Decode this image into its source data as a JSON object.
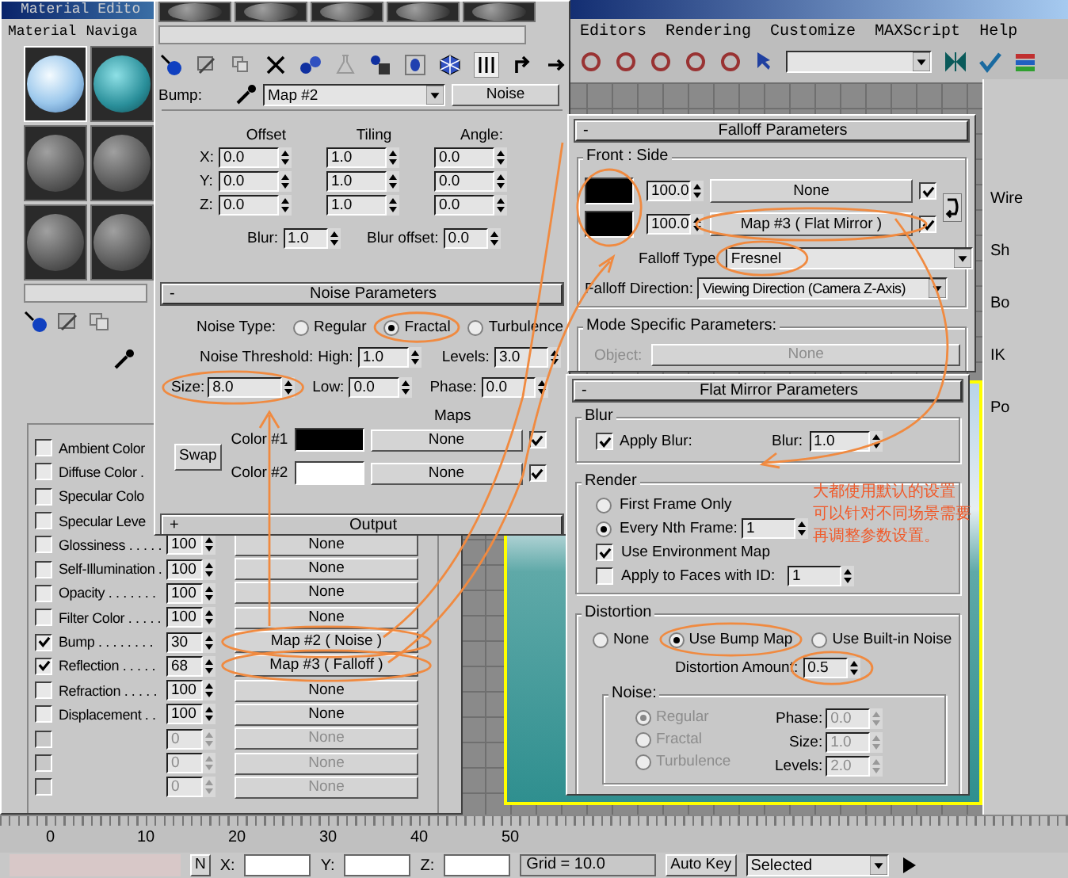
{
  "app": {
    "menu": [
      "Editors",
      "Rendering",
      "Customize",
      "MAXScript",
      "Help"
    ],
    "command_panel": [
      "Wire",
      "Sh",
      "Bo",
      "IK",
      "Po"
    ]
  },
  "back_editor": {
    "title": "Material Edito",
    "menu": [
      "Material",
      "Naviga"
    ],
    "maps": [
      {
        "label": "Ambient Color",
        "checked": false,
        "disabled": false
      },
      {
        "label": "Diffuse Color .",
        "checked": false,
        "disabled": false
      },
      {
        "label": "Specular Colo",
        "checked": false,
        "disabled": false
      },
      {
        "label": "Specular Leve",
        "checked": false,
        "disabled": false
      },
      {
        "label": "Glossiness . . . . .",
        "checked": false,
        "disabled": false,
        "amount": "100",
        "map": "None"
      },
      {
        "label": "Self-Illumination .",
        "checked": false,
        "disabled": false,
        "amount": "100",
        "map": "None"
      },
      {
        "label": "Opacity . . . . . . .",
        "checked": false,
        "disabled": false,
        "amount": "100",
        "map": "None"
      },
      {
        "label": "Filter Color . . . . .",
        "checked": false,
        "disabled": false,
        "amount": "100",
        "map": "None"
      },
      {
        "label": "Bump . . . . . . . .",
        "checked": true,
        "disabled": false,
        "amount": "30",
        "map": "Map #2  ( Noise )"
      },
      {
        "label": "Reflection . . . . .",
        "checked": true,
        "disabled": false,
        "amount": "68",
        "map": "Map #3  ( Falloff )"
      },
      {
        "label": "Refraction . . . . .",
        "checked": false,
        "disabled": false,
        "amount": "100",
        "map": "None"
      },
      {
        "label": "Displacement . .",
        "checked": false,
        "disabled": false,
        "amount": "100",
        "map": "None"
      },
      {
        "checked": false,
        "disabled": true,
        "amount": "0",
        "map": "None"
      },
      {
        "checked": false,
        "disabled": true,
        "amount": "0",
        "map": "None"
      },
      {
        "checked": false,
        "disabled": true,
        "amount": "0",
        "map": "None"
      }
    ]
  },
  "front_editor": {
    "bump": {
      "label": "Bump:",
      "map": "Map #2",
      "type": "Noise"
    },
    "coords": {
      "columns": [
        "Offset",
        "Tiling",
        "Angle:"
      ],
      "rows": [
        {
          "axis": "X:",
          "values": [
            "0.0",
            "1.0",
            "0.0"
          ]
        },
        {
          "axis": "Y:",
          "values": [
            "0.0",
            "1.0",
            "0.0"
          ]
        },
        {
          "axis": "Z:",
          "values": [
            "0.0",
            "1.0",
            "0.0"
          ]
        }
      ],
      "blur": {
        "label": "Blur:",
        "value": "1.0"
      },
      "blur_offset": {
        "label": "Blur offset:",
        "value": "0.0"
      }
    },
    "noise": {
      "sign": "-",
      "title": "Noise Parameters",
      "type_label": "Noise Type:",
      "types": [
        {
          "label": "Regular",
          "selected": false
        },
        {
          "label": "Fractal",
          "selected": true
        },
        {
          "label": "Turbulence",
          "selected": false
        }
      ],
      "threshold_label": "Noise Threshold:",
      "high": {
        "label": "High:",
        "value": "1.0"
      },
      "levels": {
        "label": "Levels:",
        "value": "3.0"
      },
      "size": {
        "label": "Size:",
        "value": "8.0"
      },
      "low": {
        "label": "Low:",
        "value": "0.0"
      },
      "phase": {
        "label": "Phase:",
        "value": "0.0"
      },
      "maps_label": "Maps",
      "swap": "Swap",
      "colors": [
        {
          "label": "Color #1",
          "color": "#000000",
          "map": "None",
          "checked": true
        },
        {
          "label": "Color #2",
          "color": "#ffffff",
          "map": "None",
          "checked": true
        }
      ]
    },
    "output": {
      "sign": "+",
      "title": "Output"
    }
  },
  "falloff": {
    "sign": "-",
    "title": "Falloff Parameters",
    "group": "Front : Side",
    "rows": [
      {
        "color": "#000000",
        "value": "100.0",
        "map": "None",
        "checked": true
      },
      {
        "color": "#000000",
        "value": "100.0",
        "map": "Map #3  ( Flat Mirror )",
        "checked": true
      }
    ],
    "type": {
      "label": "Falloff Type:",
      "value": "Fresnel"
    },
    "direction": {
      "label": "Falloff Direction:",
      "value": "Viewing Direction (Camera Z-Axis)"
    },
    "mode_group": "Mode Specific Parameters:",
    "object": {
      "label": "Object:",
      "value": "None",
      "disabled": true
    }
  },
  "flat_mirror": {
    "sign": "-",
    "title": "Flat Mirror Parameters",
    "blur_group": "Blur",
    "apply_blur": {
      "label": "Apply Blur:",
      "checked": true
    },
    "blur": {
      "label": "Blur:",
      "value": "1.0"
    },
    "render_group": "Render",
    "render_modes": [
      {
        "label": "First Frame Only",
        "selected": false
      },
      {
        "label": "Every Nth Frame:",
        "selected": true
      }
    ],
    "nth_value": "1",
    "env_map": {
      "label": "Use Environment Map",
      "checked": true
    },
    "faces": {
      "label": "Apply to Faces with ID:",
      "checked": false,
      "value": "1"
    },
    "distortion_group": "Distortion",
    "distortion_modes": [
      {
        "label": "None",
        "selected": false
      },
      {
        "label": "Use Bump Map",
        "selected": true
      },
      {
        "label": "Use Built-in Noise",
        "selected": false
      }
    ],
    "amount": {
      "label": "Distortion Amount:",
      "value": "0.5"
    },
    "noise_group": "Noise:",
    "noise_disabled": true,
    "noise_types": [
      {
        "label": "Regular",
        "selected": true
      },
      {
        "label": "Fractal",
        "selected": false
      },
      {
        "label": "Turbulence",
        "selected": false
      }
    ],
    "phase": {
      "label": "Phase:",
      "value": "0.0"
    },
    "size": {
      "label": "Size:",
      "value": "1.0"
    },
    "levels": {
      "label": "Levels:",
      "value": "2.0"
    }
  },
  "annotation_note": [
    "大都使用默认的设置",
    "可以针对不同场景需要",
    "再调整参数设置。"
  ],
  "timeline": {
    "ticks": [
      "0",
      "10",
      "20",
      "30",
      "40",
      "50"
    ],
    "n_button": "N",
    "coord_labels": [
      "X:",
      "Y:",
      "Z:"
    ],
    "grid": "Grid = 10.0",
    "auto_key": "Auto Key",
    "key_mode": "Selected"
  }
}
